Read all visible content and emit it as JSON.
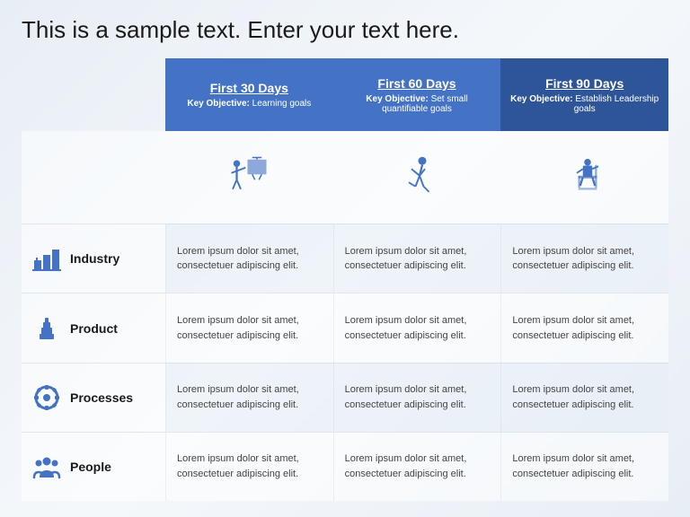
{
  "title": "This is a sample text. Enter your text here.",
  "columns": [
    {
      "label": "First 30 Days",
      "key_objective_label": "Key Objective:",
      "key_objective_value": "Learning goals",
      "style": "blue"
    },
    {
      "label": "First 60 Days",
      "key_objective_label": "Key Objective:",
      "key_objective_value": "Set small quantifiable goals",
      "style": "blue"
    },
    {
      "label": "First 90 Days",
      "key_objective_label": "Key Objective:",
      "key_objective_value": "Establish Leadership goals",
      "style": "dark-blue"
    }
  ],
  "rows": [
    {
      "label": "Industry",
      "icon": "industry",
      "cells": [
        "Lorem ipsum dolor sit amet, consectetuer adipiscing elit.",
        "Lorem ipsum dolor sit amet, consectetuer adipiscing elit.",
        "Lorem ipsum dolor sit amet, consectetuer adipiscing elit."
      ]
    },
    {
      "label": "Product",
      "icon": "product",
      "cells": [
        "Lorem ipsum dolor sit amet, consectetuer adipiscing elit.",
        "Lorem ipsum dolor sit amet, consectetuer adipiscing elit.",
        "Lorem ipsum dolor sit amet, consectetuer adipiscing elit."
      ]
    },
    {
      "label": "Processes",
      "icon": "processes",
      "cells": [
        "Lorem ipsum dolor sit amet, consectetuer adipiscing elit.",
        "Lorem ipsum dolor sit amet, consectetuer adipiscing elit.",
        "Lorem ipsum dolor sit amet, consectetuer adipiscing elit."
      ]
    },
    {
      "label": "People",
      "icon": "people",
      "cells": [
        "Lorem ipsum dolor sit amet, consectetuer adipiscing elit.",
        "Lorem ipsum dolor sit amet, consectetuer adipiscing elit.",
        "Lorem ipsum dolor sit amet, consectetuer adipiscing elit."
      ]
    }
  ]
}
